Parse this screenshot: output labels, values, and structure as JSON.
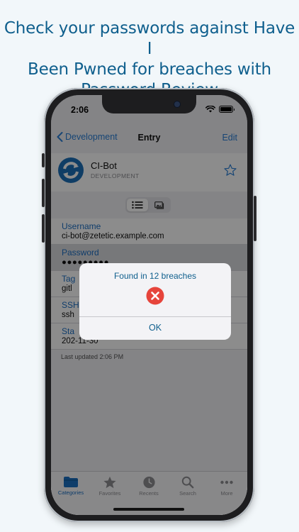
{
  "headline": {
    "line1": "Check your passwords against Have I",
    "line2": "Been Pwned for breaches with",
    "line3": "Password Review"
  },
  "status": {
    "time": "2:06"
  },
  "nav": {
    "back_label": "Development",
    "title": "Entry",
    "edit_label": "Edit"
  },
  "entry": {
    "name": "CI-Bot",
    "category": "DEVELOPMENT"
  },
  "fields": [
    {
      "label": "Username",
      "value": "ci-bot@zetetic.example.com"
    },
    {
      "label": "Password",
      "value": "●●●●●●●●●"
    },
    {
      "label": "Tag",
      "value": "gitl"
    },
    {
      "label": "SSH",
      "value": "ssh"
    },
    {
      "label": "Sta",
      "value": "202-11-30"
    }
  ],
  "updated": "Last updated 2:06 PM",
  "alert": {
    "title": "Found in 12 breaches",
    "ok_label": "OK",
    "icon": "error-x-icon"
  },
  "tabs": [
    {
      "label": "Categories",
      "icon": "folder-icon",
      "active": true
    },
    {
      "label": "Favorites",
      "icon": "star-icon"
    },
    {
      "label": "Recents",
      "icon": "clock-icon"
    },
    {
      "label": "Search",
      "icon": "search-icon"
    },
    {
      "label": "More",
      "icon": "ellipsis-icon"
    }
  ],
  "colors": {
    "accent": "#2a7fd6",
    "headline": "#0f5f8d",
    "error": "#e6443b"
  }
}
